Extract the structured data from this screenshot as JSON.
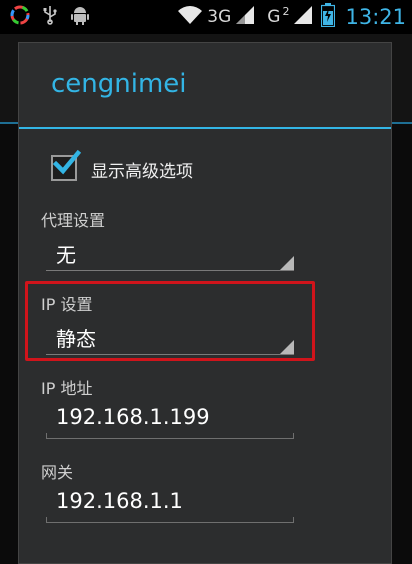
{
  "status_bar": {
    "network_3g": "3G",
    "network_g": "G",
    "sim2_badge": "2",
    "time": "13:21"
  },
  "dialog": {
    "title": "cengnimei",
    "show_advanced_label": "显示高级选项",
    "show_advanced_checked": true,
    "proxy_label": "代理设置",
    "proxy_value": "无",
    "ip_settings_label": "IP 设置",
    "ip_settings_value": "静态",
    "ip_address_label": "IP 地址",
    "ip_address_value": "192.168.1.199",
    "gateway_label": "网关",
    "gateway_value": "192.168.1.1"
  },
  "colors": {
    "accent": "#33b5e5",
    "highlight_box": "#d0141b",
    "dialog_bg": "#2c2d2e"
  }
}
